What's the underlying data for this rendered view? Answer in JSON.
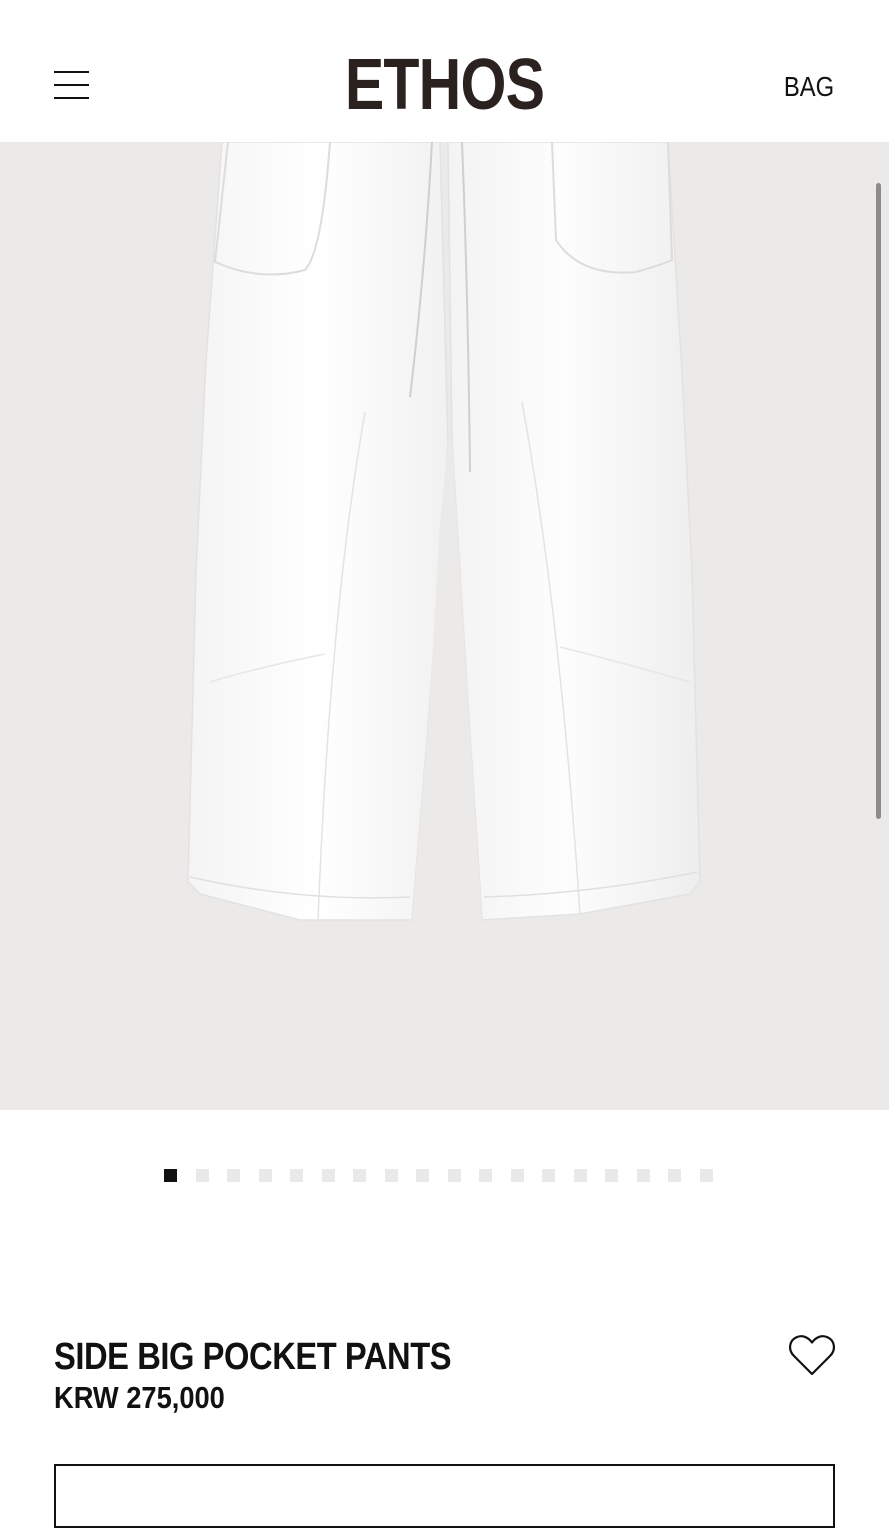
{
  "header": {
    "logo": "ETHOS",
    "bag_label": "BAG"
  },
  "gallery": {
    "slide_count": 18,
    "active_index": 0,
    "background": "#ebeae8"
  },
  "product": {
    "name": "SIDE BIG POCKET PANTS",
    "price": "KRW 275,000"
  },
  "icons": {
    "menu": "hamburger-menu-icon",
    "wishlist": "heart-icon"
  },
  "colors": {
    "logo": "#2b2220",
    "text": "#111111",
    "dot_active": "#111111",
    "dot_inactive": "#e9e9e9"
  }
}
